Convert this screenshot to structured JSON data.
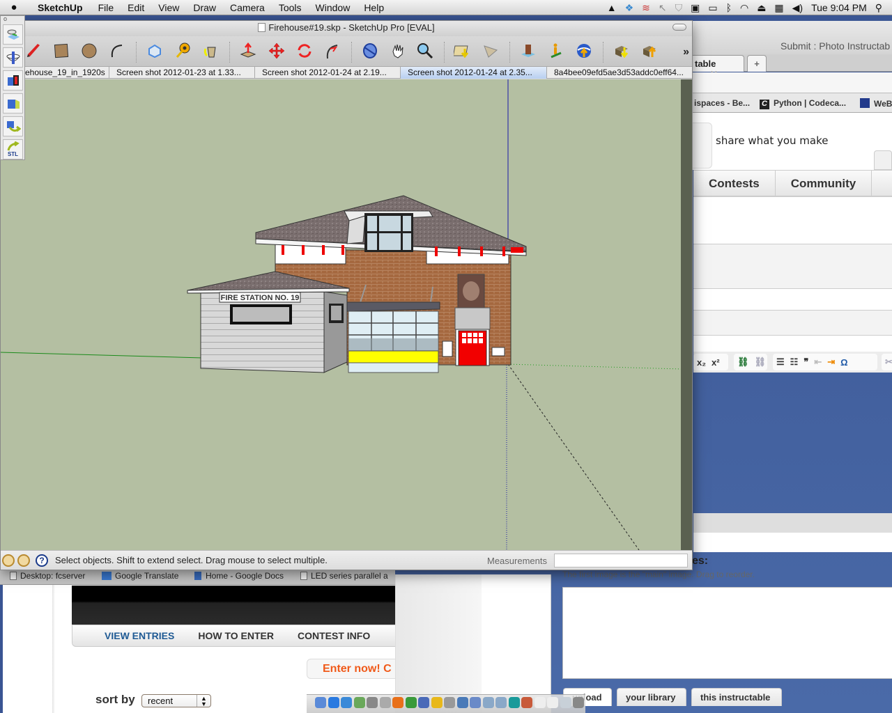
{
  "menubar": {
    "app_name": "SketchUp",
    "items": [
      "File",
      "Edit",
      "View",
      "Draw",
      "Camera",
      "Tools",
      "Window",
      "Help"
    ],
    "status_icons": [
      "google-drive-icon",
      "dropbox-icon",
      "sync-icon",
      "cursor-icon",
      "shield-icon",
      "photo-booth-icon",
      "display-icon",
      "bluetooth-icon",
      "wifi-icon",
      "eject-icon",
      "keyboard-icon",
      "volume-icon"
    ],
    "clock": "Tue 9:04 PM",
    "spotlight": "spotlight-icon"
  },
  "sketchup": {
    "title": "Firehouse#19.skp - SketchUp Pro [EVAL]",
    "toolbar": [
      {
        "name": "pencil-tool",
        "tip": "Line"
      },
      {
        "name": "rectangle-tool",
        "tip": "Rectangle"
      },
      {
        "name": "circle-tool",
        "tip": "Circle"
      },
      {
        "name": "arc-tool",
        "tip": "Arc"
      },
      {
        "name": "make-component-tool",
        "tip": "Make Component"
      },
      {
        "name": "tape-measure-tool",
        "tip": "Tape Measure"
      },
      {
        "name": "paint-bucket-tool",
        "tip": "Paint Bucket"
      },
      {
        "name": "push-pull-tool",
        "tip": "Push/Pull"
      },
      {
        "name": "move-tool",
        "tip": "Move"
      },
      {
        "name": "rotate-tool",
        "tip": "Rotate"
      },
      {
        "name": "follow-me-tool",
        "tip": "Follow Me"
      },
      {
        "name": "orbit-tool",
        "tip": "Orbit"
      },
      {
        "name": "pan-tool",
        "tip": "Pan"
      },
      {
        "name": "zoom-tool",
        "tip": "Zoom"
      },
      {
        "name": "get-current-view-tool",
        "tip": "Get Current View"
      },
      {
        "name": "toggle-terrain-tool",
        "tip": "Toggle Terrain"
      },
      {
        "name": "add-building-tool",
        "tip": "Add Building"
      },
      {
        "name": "add-location-tool",
        "tip": "Add Location"
      },
      {
        "name": "share-model-tool",
        "tip": "Share Model"
      },
      {
        "name": "get-models-tool",
        "tip": "Get Models"
      },
      {
        "name": "share-component-tool",
        "tip": "Share Component"
      }
    ],
    "more": "»",
    "scenes": [
      {
        "label": "ehouse_19_in_1920s",
        "active": false
      },
      {
        "label": "Screen shot 2012-01-23 at 1.33...",
        "active": false
      },
      {
        "label": "Screen shot 2012-01-24 at 2.19...",
        "active": false
      },
      {
        "label": "Screen shot 2012-01-24 at 2.35...",
        "active": true
      },
      {
        "label": "8a4bee09efd5ae3d53addc0eff64...",
        "active": false
      }
    ],
    "model": {
      "sign_text": "FIRE STATION NO. 19"
    },
    "status": {
      "message": "Select objects. Shift to extend select. Drag mouse to select multiple.",
      "measurements_label": "Measurements",
      "measurements_value": ""
    },
    "palette": [
      "add-model-icon",
      "section-plane-icon",
      "solid-tools-icon",
      "photo-textures-icon",
      "export-icon",
      "stl-export-icon"
    ],
    "palette_stl_label": "STL"
  },
  "browser": {
    "title": "Submit : Photo Instructab",
    "tab_label": "table",
    "new_tab": "+",
    "bookmarks": [
      "ispaces - Be...",
      "Python | Codeca...",
      "WeB"
    ],
    "tagline": "share what you make",
    "nav": [
      "Contests",
      "Community"
    ],
    "editor_tools": [
      "x₂",
      "x²"
    ],
    "images_label": "es:",
    "images_help": "The first image is the \"main\" image. Drag to reorder.",
    "upload_tabs": [
      "upload",
      "your library",
      "this instructable"
    ],
    "bookmarks_bottom": [
      "Desktop: fcserver",
      "Google Translate",
      "Home - Google Docs",
      "LED series parallel a"
    ],
    "contest_nav": [
      "VIEW ENTRIES",
      "HOW TO ENTER",
      "CONTEST INFO"
    ],
    "enter_now": "Enter now! C",
    "sort_label": "sort by",
    "sort_value": "recent"
  },
  "dock": [
    "finder",
    "app-store",
    "wunderlist",
    "disk-utility",
    "screenshot",
    "grab",
    "firefox",
    "chrome",
    "virtualbox",
    "wireshark",
    "pen",
    "python",
    "preview",
    "x11",
    "x11-2",
    "arduino",
    "sketchup",
    "doc",
    "doc2",
    "trash",
    "mug"
  ],
  "colors": {
    "viewport_bg": "#b4bfa2",
    "accent_blue": "#1f5a94",
    "enter_orange": "#f05a1a",
    "door_red": "#f20000",
    "bay_yellow": "#ffff00"
  }
}
